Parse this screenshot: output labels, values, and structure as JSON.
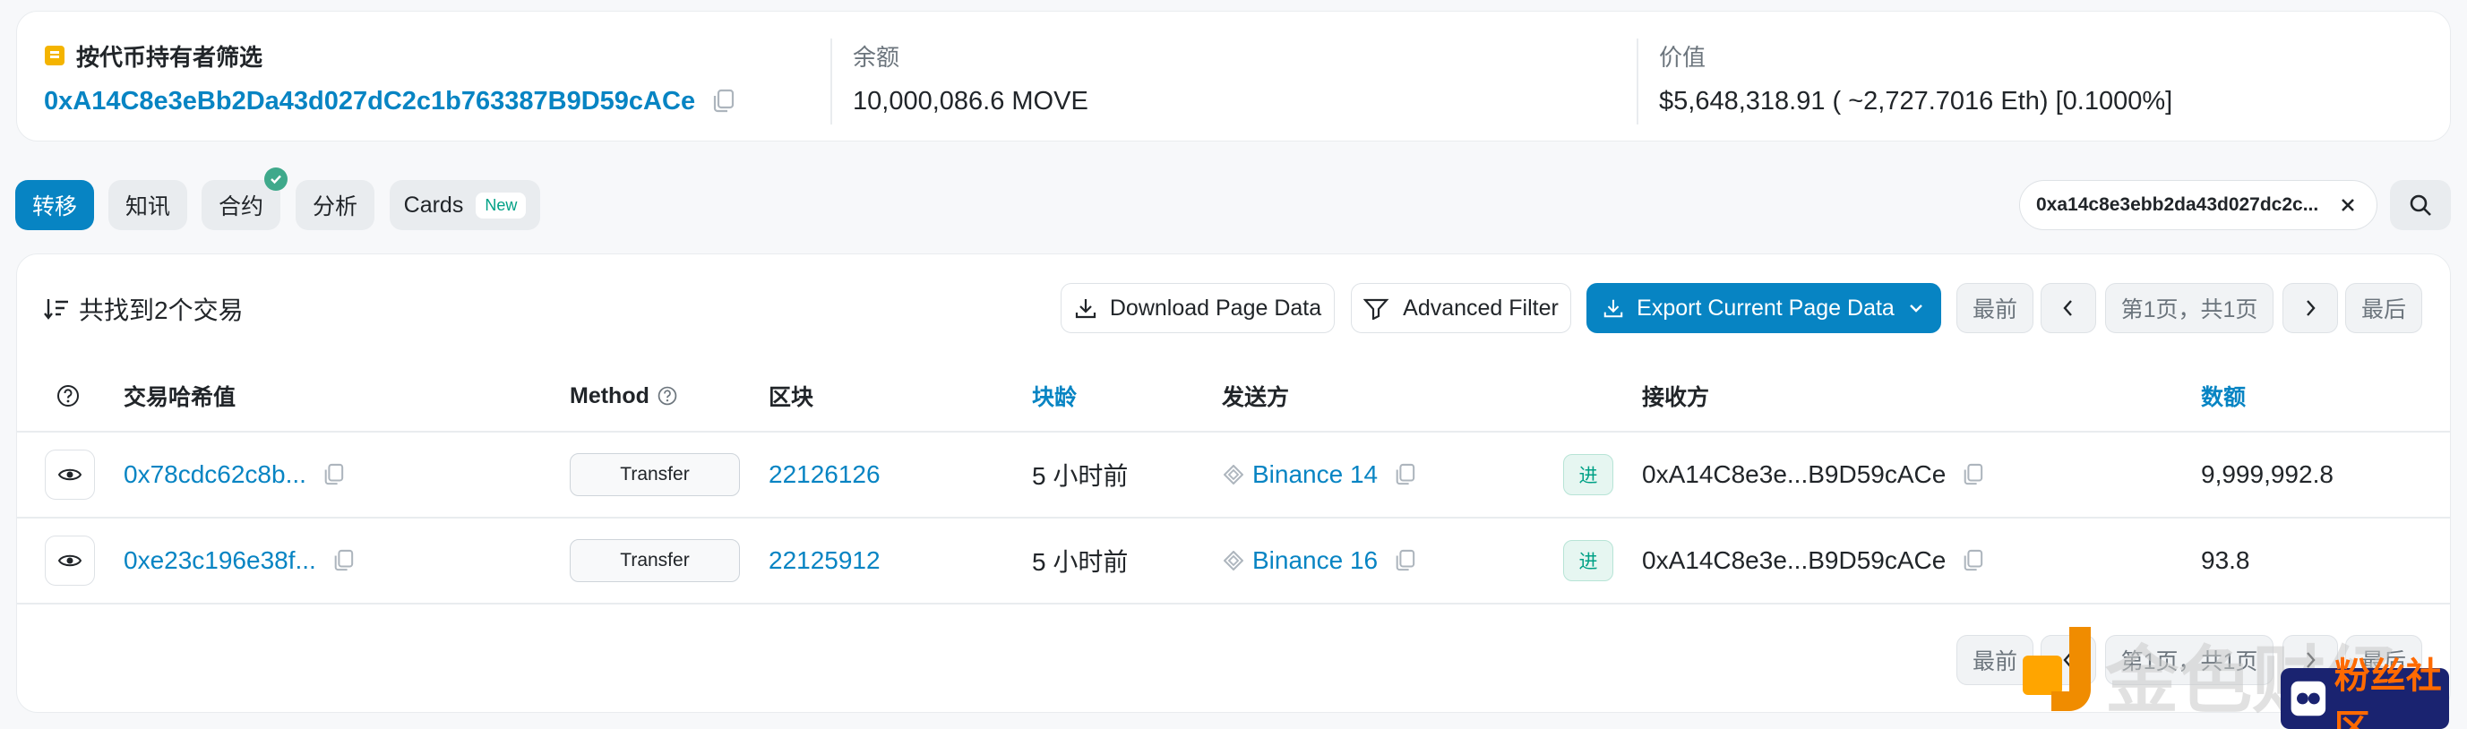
{
  "summary": {
    "filter_label": "按代币持有者筛选",
    "filter_address": "0xA14C8e3eBb2Da43d027dC2c1b763387B9D59cACe",
    "balance_label": "余额",
    "balance_value": "10,000,086.6 MOVE",
    "value_label": "价值",
    "value_value": "$5,648,318.91 ( ~2,727.7016 Eth) [0.1000%]"
  },
  "tabs": [
    {
      "label": "转移",
      "active": true
    },
    {
      "label": "知讯"
    },
    {
      "label": "合约",
      "verified": true
    },
    {
      "label": "分析"
    },
    {
      "label": "Cards",
      "badge": "New"
    }
  ],
  "address_filter": "0xa14c8e3ebb2da43d027dc2c...",
  "toolbar": {
    "found_text": "共找到2个交易",
    "download_label": "Download Page Data",
    "filter_label": "Advanced Filter",
    "export_label": "Export Current Page Data",
    "first_label": "最前",
    "page_label": "第1页，共1页",
    "last_label": "最后"
  },
  "table": {
    "columns": [
      "交易哈希值",
      "Method",
      "区块",
      "块龄",
      "发送方",
      "接收方",
      "数额"
    ],
    "rows": [
      {
        "hash": "0x78cdc62c8b...",
        "method": "Transfer",
        "block": "22126126",
        "age": "5 小时前",
        "from": "Binance 14",
        "direction": "进",
        "to": "0xA14C8e3e...B9D59cACe",
        "amount": "9,999,992.8"
      },
      {
        "hash": "0xe23c196e38f...",
        "method": "Transfer",
        "block": "22125912",
        "age": "5 小时前",
        "from": "Binance 16",
        "direction": "进",
        "to": "0xA14C8e3e...B9D59cACe",
        "amount": "93.8"
      }
    ]
  },
  "footer": {
    "first_label": "最前",
    "page_label": "第1页，共1页",
    "last_label": "最后"
  },
  "watermark": {
    "text": "金色财经",
    "logo_text": "粉丝社区"
  },
  "colors": {
    "accent": "#0784c3",
    "success": "#00a186",
    "watermark_orange": "#ff8c00"
  },
  "icons": [
    "token-icon",
    "copy-icon",
    "sort-icon",
    "download-icon",
    "filter-icon",
    "chevron-down-icon",
    "chevron-left-icon",
    "chevron-right-icon",
    "close-icon",
    "search-icon",
    "help-icon",
    "eye-icon",
    "contract-icon",
    "check-icon"
  ]
}
